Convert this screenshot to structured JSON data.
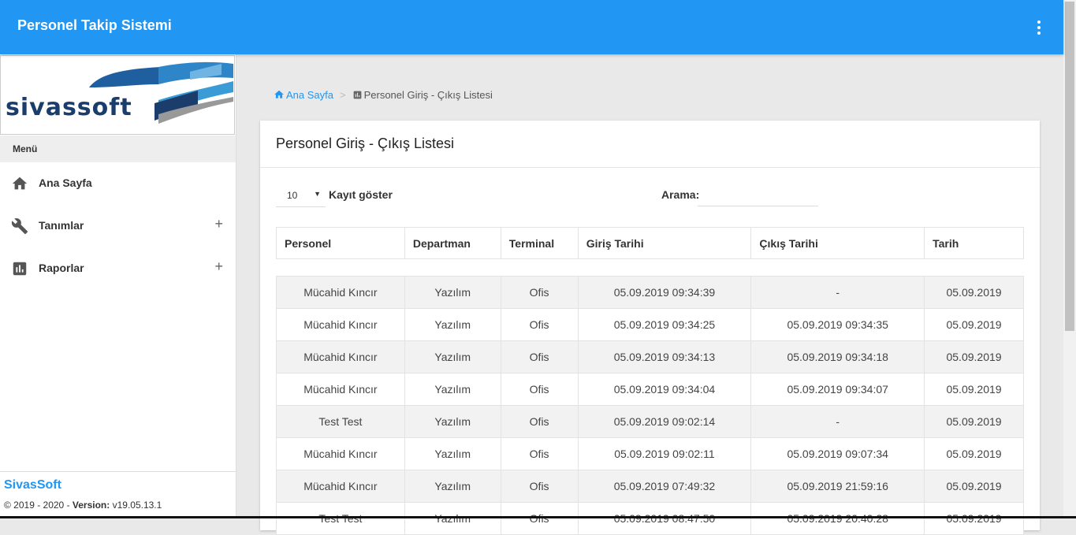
{
  "app": {
    "title": "Personel Takip Sistemi"
  },
  "sidebar": {
    "logo_text": "sivassoft",
    "menu_header": "Menü",
    "items": [
      {
        "label": "Ana Sayfa",
        "icon": "home-icon",
        "expandable": false
      },
      {
        "label": "Tanımlar",
        "icon": "wrench-icon",
        "expandable": true,
        "toggle": "+"
      },
      {
        "label": "Raporlar",
        "icon": "bar-chart-icon",
        "expandable": true,
        "toggle": "+"
      }
    ],
    "footer": {
      "brand": "SivasSoft",
      "copyright_prefix": "© 2019 - 2020 - ",
      "version_label": "Version:",
      "version_value": " v19.05.13.1"
    }
  },
  "breadcrumb": {
    "home": "Ana Sayfa",
    "separator": ">",
    "current": "Personel Giriş - Çıkış Listesi"
  },
  "card": {
    "title": "Personel Giriş - Çıkış Listesi",
    "page_length": "10",
    "page_length_suffix": "Kayıt göster",
    "search_label": "Arama:",
    "search_value": ""
  },
  "table": {
    "columns": [
      "Personel",
      "Departman",
      "Terminal",
      "Giriş Tarihi",
      "Çıkış Tarihi",
      "Tarih"
    ],
    "rows": [
      [
        "Mücahid Kıncır",
        "Yazılım",
        "Ofis",
        "05.09.2019 09:34:39",
        "-",
        "05.09.2019"
      ],
      [
        "Mücahid Kıncır",
        "Yazılım",
        "Ofis",
        "05.09.2019 09:34:25",
        "05.09.2019 09:34:35",
        "05.09.2019"
      ],
      [
        "Mücahid Kıncır",
        "Yazılım",
        "Ofis",
        "05.09.2019 09:34:13",
        "05.09.2019 09:34:18",
        "05.09.2019"
      ],
      [
        "Mücahid Kıncır",
        "Yazılım",
        "Ofis",
        "05.09.2019 09:34:04",
        "05.09.2019 09:34:07",
        "05.09.2019"
      ],
      [
        "Test Test",
        "Yazılım",
        "Ofis",
        "05.09.2019 09:02:14",
        "-",
        "05.09.2019"
      ],
      [
        "Mücahid Kıncır",
        "Yazılım",
        "Ofis",
        "05.09.2019 09:02:11",
        "05.09.2019 09:07:34",
        "05.09.2019"
      ],
      [
        "Mücahid Kıncır",
        "Yazılım",
        "Ofis",
        "05.09.2019 07:49:32",
        "05.09.2019 21:59:16",
        "05.09.2019"
      ],
      [
        "Test Test",
        "Yazılım",
        "Ofis",
        "05.09.2019 08:47:50",
        "05.09.2019 20:40:28",
        "05.09.2019"
      ]
    ]
  },
  "colors": {
    "primary": "#2196f3",
    "background": "#e9e9e9",
    "row_striped": "#f2f2f2"
  }
}
